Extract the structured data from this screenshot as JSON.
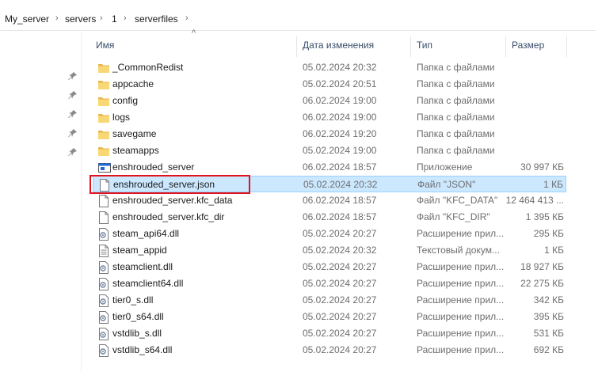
{
  "breadcrumb": {
    "items": [
      "My_server",
      "servers",
      "1",
      "serverfiles"
    ],
    "separator": "›"
  },
  "columns": {
    "name": "Имя",
    "date": "Дата изменения",
    "type": "Тип",
    "size": "Размер",
    "sort_indicator": "^"
  },
  "files": [
    {
      "name": "_CommonRedist",
      "date": "05.02.2024 20:32",
      "type": "Папка с файлами",
      "size": "",
      "icon": "folder-icon"
    },
    {
      "name": "appcache",
      "date": "05.02.2024 20:51",
      "type": "Папка с файлами",
      "size": "",
      "icon": "folder-icon"
    },
    {
      "name": "config",
      "date": "06.02.2024 19:00",
      "type": "Папка с файлами",
      "size": "",
      "icon": "folder-icon"
    },
    {
      "name": "logs",
      "date": "06.02.2024 19:00",
      "type": "Папка с файлами",
      "size": "",
      "icon": "folder-icon"
    },
    {
      "name": "savegame",
      "date": "06.02.2024 19:20",
      "type": "Папка с файлами",
      "size": "",
      "icon": "folder-icon"
    },
    {
      "name": "steamapps",
      "date": "05.02.2024 19:00",
      "type": "Папка с файлами",
      "size": "",
      "icon": "folder-icon"
    },
    {
      "name": "enshrouded_server",
      "date": "06.02.2024 18:57",
      "type": "Приложение",
      "size": "30 997 КБ",
      "icon": "application-icon"
    },
    {
      "name": "enshrouded_server.json",
      "date": "05.02.2024 20:32",
      "type": "Файл \"JSON\"",
      "size": "1 КБ",
      "icon": "file-icon",
      "selected": true
    },
    {
      "name": "enshrouded_server.kfc_data",
      "date": "06.02.2024 18:57",
      "type": "Файл \"KFC_DATA\"",
      "size": "12 464 413 ...",
      "icon": "file-icon"
    },
    {
      "name": "enshrouded_server.kfc_dir",
      "date": "06.02.2024 18:57",
      "type": "Файл \"KFC_DIR\"",
      "size": "1 395 КБ",
      "icon": "file-icon"
    },
    {
      "name": "steam_api64.dll",
      "date": "05.02.2024 20:27",
      "type": "Расширение прил...",
      "size": "295 КБ",
      "icon": "dll-icon"
    },
    {
      "name": "steam_appid",
      "date": "05.02.2024 20:32",
      "type": "Текстовый докум...",
      "size": "1 КБ",
      "icon": "text-file-icon"
    },
    {
      "name": "steamclient.dll",
      "date": "05.02.2024 20:27",
      "type": "Расширение прил...",
      "size": "18 927 КБ",
      "icon": "dll-icon"
    },
    {
      "name": "steamclient64.dll",
      "date": "05.02.2024 20:27",
      "type": "Расширение прил...",
      "size": "22 275 КБ",
      "icon": "dll-icon"
    },
    {
      "name": "tier0_s.dll",
      "date": "05.02.2024 20:27",
      "type": "Расширение прил...",
      "size": "342 КБ",
      "icon": "dll-icon"
    },
    {
      "name": "tier0_s64.dll",
      "date": "05.02.2024 20:27",
      "type": "Расширение прил...",
      "size": "395 КБ",
      "icon": "dll-icon"
    },
    {
      "name": "vstdlib_s.dll",
      "date": "05.02.2024 20:27",
      "type": "Расширение прил...",
      "size": "531 КБ",
      "icon": "dll-icon"
    },
    {
      "name": "vstdlib_s64.dll",
      "date": "05.02.2024 20:27",
      "type": "Расширение прил...",
      "size": "692 КБ",
      "icon": "dll-icon"
    }
  ],
  "colors": {
    "folder": "#f8d775",
    "selection_bg": "#cce8ff",
    "selection_border": "#99d1ff",
    "highlight": "#e0131e"
  }
}
